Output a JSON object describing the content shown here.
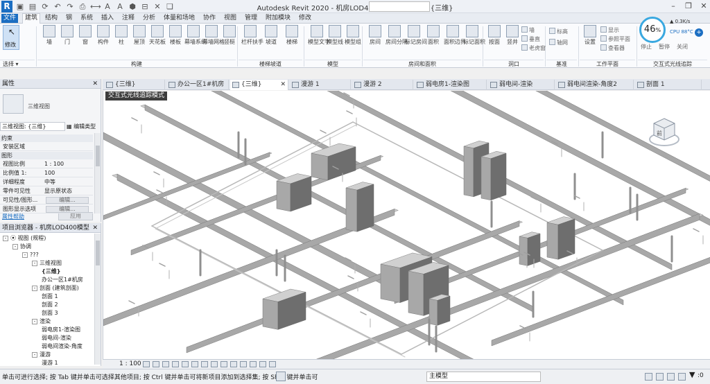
{
  "window": {
    "title": "Autodesk Revit 2020 - 机房LOD400模型 - 三维视图: {三维}",
    "app_logo": "R"
  },
  "quick_access": [
    "folder-open-icon",
    "save-icon",
    "sync-icon",
    "undo-icon",
    "redo-icon",
    "print-icon",
    "measure-icon",
    "annotation-icon",
    "text-icon",
    "3d-view-icon",
    "section-icon",
    "close-views-icon",
    "switch-windows-icon"
  ],
  "ribbon_tabs": [
    "文件",
    "建筑",
    "结构",
    "钢",
    "系统",
    "插入",
    "注释",
    "分析",
    "体量和场地",
    "协作",
    "视图",
    "管理",
    "附加模块",
    "修改"
  ],
  "ribbon_active_tab": "建筑",
  "ribbon": {
    "select": {
      "modify": "修改",
      "panel": "选择"
    },
    "build": {
      "buttons": [
        "墙",
        "门",
        "窗",
        "构件",
        "柱",
        "屋顶",
        "天花板",
        "楼板",
        "幕墙系统",
        "幕墙网格",
        "竖梃"
      ],
      "panel": "构建"
    },
    "circulation": {
      "buttons": [
        "栏杆扶手",
        "坡道",
        "楼梯"
      ],
      "panel": "楼梯坡道"
    },
    "model": {
      "buttons": [
        "模型文字",
        "模型线",
        "模型组"
      ],
      "panel": "模型"
    },
    "room": {
      "buttons": [
        "房间",
        "房间分隔",
        "标记房间",
        "面积",
        "面积边界",
        "标记面积"
      ],
      "panel": "房间和面积"
    },
    "opening": {
      "buttons": [
        "按面",
        "竖井",
        "墙",
        "垂直",
        "老虎窗"
      ],
      "panel": "洞口"
    },
    "datum": {
      "buttons": [
        "标高",
        "轴网"
      ],
      "panel": "基准"
    },
    "workplane": {
      "buttons": [
        "设置",
        "显示",
        "参照平面",
        "查看器"
      ],
      "panel": "工作平面"
    },
    "raytrace": {
      "buttons": [
        "停止",
        "暂停",
        "关闭"
      ],
      "panel": "交互式光线追踪"
    }
  },
  "cpu_widget": {
    "percent": "46",
    "percent_unit": "%",
    "net": "0.3K/s",
    "label": "CPU 88°C"
  },
  "properties": {
    "title": "属性",
    "type_name": "三维视图",
    "selector": "三维视图: {三维}",
    "edit_type": "编辑类型",
    "rows": [
      {
        "section": "约束"
      },
      {
        "k": "安装区域",
        "v": ""
      },
      {
        "section": "图形"
      },
      {
        "k": "视图比例",
        "v": "1 : 100"
      },
      {
        "k": "比例值 1:",
        "v": "100"
      },
      {
        "k": "详细程度",
        "v": "中等"
      },
      {
        "k": "零件可见性",
        "v": "显示原状态"
      },
      {
        "k": "可见性/图形...",
        "v": "编辑..."
      },
      {
        "k": "图形显示选项",
        "v": "编辑..."
      }
    ],
    "help": "属性帮助",
    "apply": "应用"
  },
  "browser": {
    "title": "项目浏览器 - 机房LOD400模型",
    "nodes": [
      {
        "t": "视图 (规程)",
        "lvl": 0,
        "tog": "-"
      },
      {
        "t": "协调",
        "lvl": 1,
        "tog": "-"
      },
      {
        "t": "???",
        "lvl": 2,
        "tog": "-"
      },
      {
        "t": "三维视图",
        "lvl": 3,
        "tog": "-"
      },
      {
        "t": "{三维}",
        "lvl": 4,
        "tog": ""
      },
      {
        "t": "办公一区1#机房",
        "lvl": 4,
        "tog": ""
      },
      {
        "t": "剖面 (建筑剖面)",
        "lvl": 3,
        "tog": "-"
      },
      {
        "t": "剖面 1",
        "lvl": 4,
        "tog": ""
      },
      {
        "t": "剖面 2",
        "lvl": 4,
        "tog": ""
      },
      {
        "t": "剖面 3",
        "lvl": 4,
        "tog": ""
      },
      {
        "t": "渲染",
        "lvl": 3,
        "tog": "-"
      },
      {
        "t": "弱电房1-渲染图",
        "lvl": 4,
        "tog": ""
      },
      {
        "t": "弱电间-渲染",
        "lvl": 4,
        "tog": ""
      },
      {
        "t": "弱电间渲染-角度",
        "lvl": 4,
        "tog": ""
      },
      {
        "t": "漫游",
        "lvl": 3,
        "tog": "-"
      },
      {
        "t": "漫游 1",
        "lvl": 4,
        "tog": ""
      }
    ]
  },
  "view_tabs": [
    {
      "label": "{三维}",
      "active": false
    },
    {
      "label": "办公一区1#机房",
      "active": false
    },
    {
      "label": "{三维}",
      "active": true
    },
    {
      "label": "漫游 1",
      "active": false
    },
    {
      "label": "漫游 2",
      "active": false
    },
    {
      "label": "弱电房1-渲染图",
      "active": false
    },
    {
      "label": "弱电间-渲染",
      "active": false
    },
    {
      "label": "弱电间渲染-角度2",
      "active": false
    },
    {
      "label": "剖面 1",
      "active": false
    }
  ],
  "viewport": {
    "mode_badge": "交互式光线追踪模式",
    "viewcube_face": "前",
    "scale": "1 : 100"
  },
  "status": {
    "text": "单击可进行选择; 按 Tab 键并单击可选择其他项目; 按 Ctrl 键并单击可将新项目添加到选择集; 按 Shift 键并单击可",
    "workset": "主模型",
    "filter_count": ":0"
  },
  "colors": {
    "accent": "#1b6ec2",
    "ribbon_bg": "#fafbfd",
    "model_gray": "#a8a8a8",
    "model_dark": "#6e6e6e"
  }
}
